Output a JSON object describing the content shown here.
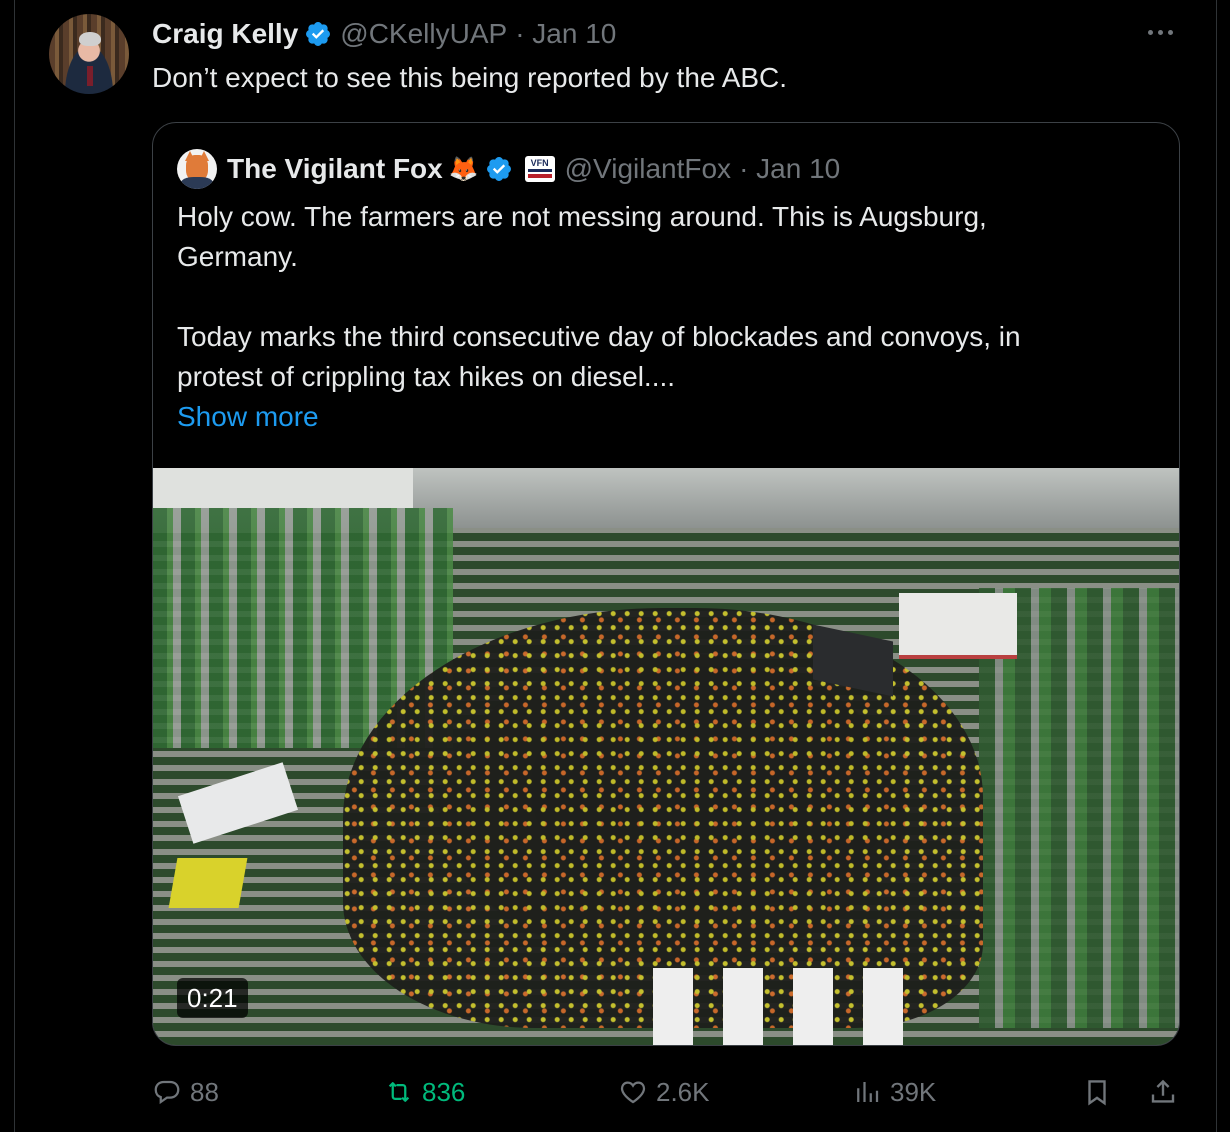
{
  "tweet": {
    "author_name": "Craig Kelly",
    "handle": "@CKellyUAP",
    "date": "· Jan 10",
    "text": "Don’t expect to see this being reported by the ABC."
  },
  "quoted": {
    "author_name": "The Vigilant Fox",
    "author_emoji": "🦊",
    "handle": "@VigilantFox",
    "date": "· Jan 10",
    "badge_text": "VFN",
    "lines": [
      "Holy cow. The farmers are not messing around. This is Augsburg,",
      "Germany.",
      "",
      "Today marks the third consecutive day of blockades and convoys, in",
      "protest of crippling tax hikes on diesel...."
    ],
    "show_more": "Show more",
    "video_duration": "0:21"
  },
  "actions": {
    "replies": "88",
    "reposts": "836",
    "likes": "2.6K",
    "views": "39K"
  },
  "colors": {
    "background": "#000000",
    "text": "#e7e9ea",
    "muted": "#71767b",
    "link": "#1d9bf0",
    "verified": "#1d9bf0",
    "repost_active": "#00ba7c"
  },
  "icons": [
    "verified-badge-icon",
    "more-options-icon",
    "reply-icon",
    "repost-icon",
    "like-icon",
    "views-icon",
    "bookmark-icon",
    "share-icon"
  ]
}
